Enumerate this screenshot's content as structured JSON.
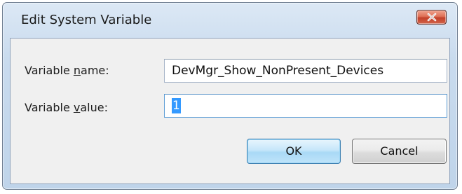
{
  "window": {
    "title": "Edit System Variable"
  },
  "fields": {
    "name_label_pre": "Variable ",
    "name_label_access": "n",
    "name_label_post": "ame:",
    "name_value": "DevMgr_Show_NonPresent_Devices",
    "value_label_pre": "Variable ",
    "value_label_access": "v",
    "value_label_post": "alue:",
    "value_value": "1"
  },
  "buttons": {
    "ok_label": "OK",
    "cancel_label": "Cancel"
  },
  "icons": {
    "close": "close-x-icon"
  },
  "colors": {
    "selection": "#3399ff",
    "close_button": "#c2412a"
  }
}
